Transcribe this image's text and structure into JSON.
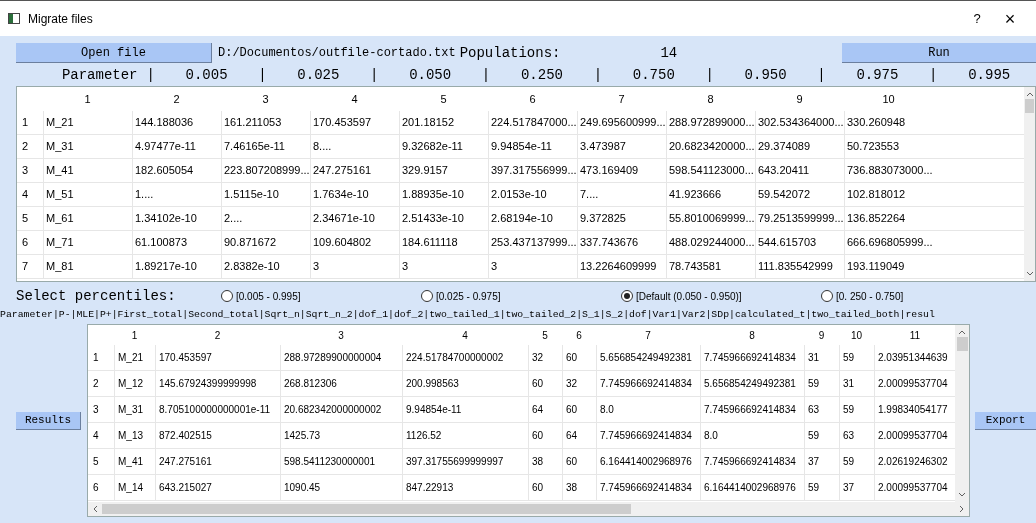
{
  "window": {
    "title": "Migrate files",
    "help": "?",
    "close": "×"
  },
  "toolbar": {
    "open_button": "Open file",
    "file_path": "D:/Documentos/outfile-cortado.txt",
    "populations_label": "Populations:",
    "populations_value": "14",
    "run_button": "Run"
  },
  "parameter_header": [
    "Parameter",
    "|",
    "0.005",
    "|",
    "0.025",
    "|",
    "0.050",
    "|",
    "0.250",
    "|",
    "0.750",
    "|",
    "0.950",
    "|",
    "0.975",
    "|",
    "0.995"
  ],
  "top_table": {
    "columns": [
      "1",
      "2",
      "3",
      "4",
      "5",
      "6",
      "7",
      "8",
      "9",
      "10"
    ],
    "rows": [
      {
        "index": "1",
        "cells": [
          "M_21",
          "144.188036",
          "161.211053",
          "170.453597",
          "201.18152",
          "224.517847000...",
          "249.695600999...",
          "288.972899000...",
          "302.534364000...",
          "330.260948"
        ]
      },
      {
        "index": "2",
        "cells": [
          "M_31",
          "4.97477e-11",
          "7.46165e-11",
          "8....",
          "9.32682e-11",
          "9.94854e-11",
          "3.473987",
          "20.6823420000...",
          "29.374089",
          "50.723553"
        ]
      },
      {
        "index": "3",
        "cells": [
          "M_41",
          "182.605054",
          "223.807208999...",
          "247.275161",
          "329.9157",
          "397.317556999...",
          "473.169409",
          "598.541123000...",
          "643.20411",
          "736.883073000..."
        ]
      },
      {
        "index": "4",
        "cells": [
          "M_51",
          "1....",
          "1.5115e-10",
          "1.7634e-10",
          "1.88935e-10",
          "2.0153e-10",
          "7....",
          "41.923666",
          "59.542072",
          "102.818012"
        ]
      },
      {
        "index": "5",
        "cells": [
          "M_61",
          "1.34102e-10",
          "2....",
          "2.34671e-10",
          "2.51433e-10",
          "2.68194e-10",
          "9.372825",
          "55.8010069999...",
          "79.2513599999...",
          "136.852264"
        ]
      },
      {
        "index": "6",
        "cells": [
          "M_71",
          "61.100873",
          "90.871672",
          "109.604802",
          "184.611118",
          "253.437137999...",
          "337.743676",
          "488.029244000...",
          "544.615703",
          "666.696805999..."
        ]
      },
      {
        "index": "7",
        "cells": [
          "M_81",
          "1.89217e-10",
          "2.8382e-10",
          "3",
          "3",
          "3",
          "13.2264609999",
          "78.743581",
          "111.835542999",
          "193.119049"
        ]
      }
    ]
  },
  "percentiles": {
    "label": "Select percentiles:",
    "options": [
      {
        "label": "[0.005 - 0.995]",
        "selected": false
      },
      {
        "label": "[0.025 - 0.975]",
        "selected": false
      },
      {
        "label": "[Default (0.050 - 0.950)]",
        "selected": true
      },
      {
        "label": "[0. 250 - 0.750]",
        "selected": false
      }
    ]
  },
  "results_header": "Parameter|P-|MLE|P+|First_total|Second_total|Sqrt_n|Sqrt_n_2|dof_1|dof_2|two_tailed_1|two_tailed_2|S_1|S_2|dof|Var1|Var2|SDp|calculated_t|two_tailed_both|resul",
  "results_button": "Results",
  "export_button": "Export",
  "results_table": {
    "columns": [
      "1",
      "2",
      "3",
      "4",
      "5",
      "6",
      "7",
      "8",
      "9",
      "10",
      "11"
    ],
    "rows": [
      {
        "index": "1",
        "cells": [
          "M_21",
          "170.453597",
          "288.97289900000004",
          "224.51784700000002",
          "32",
          "60",
          "5.656854249492381",
          "7.745966692414834",
          "31",
          "59",
          "2.03951344639"
        ]
      },
      {
        "index": "2",
        "cells": [
          "M_12",
          "145.67924399999998",
          "268.812306",
          "200.998563",
          "60",
          "32",
          "7.745966692414834",
          "5.656854249492381",
          "59",
          "31",
          "2.00099537704"
        ]
      },
      {
        "index": "3",
        "cells": [
          "M_31",
          "8.705100000000001e-11",
          "20.682342000000002",
          "9.94854e-11",
          "64",
          "60",
          "8.0",
          "7.745966692414834",
          "63",
          "59",
          "1.99834054177"
        ]
      },
      {
        "index": "4",
        "cells": [
          "M_13",
          "872.402515",
          "1425.73",
          "1126.52",
          "60",
          "64",
          "7.745966692414834",
          "8.0",
          "59",
          "63",
          "2.00099537704"
        ]
      },
      {
        "index": "5",
        "cells": [
          "M_41",
          "247.275161",
          "598.5411230000001",
          "397.31755699999997",
          "38",
          "60",
          "6.164414002968976",
          "7.745966692414834",
          "37",
          "59",
          "2.02619246302"
        ]
      },
      {
        "index": "6",
        "cells": [
          "M_14",
          "643.215027",
          "1090.45",
          "847.22913",
          "60",
          "38",
          "7.745966692414834",
          "6.164414002968976",
          "59",
          "37",
          "2.00099537704"
        ]
      }
    ]
  }
}
